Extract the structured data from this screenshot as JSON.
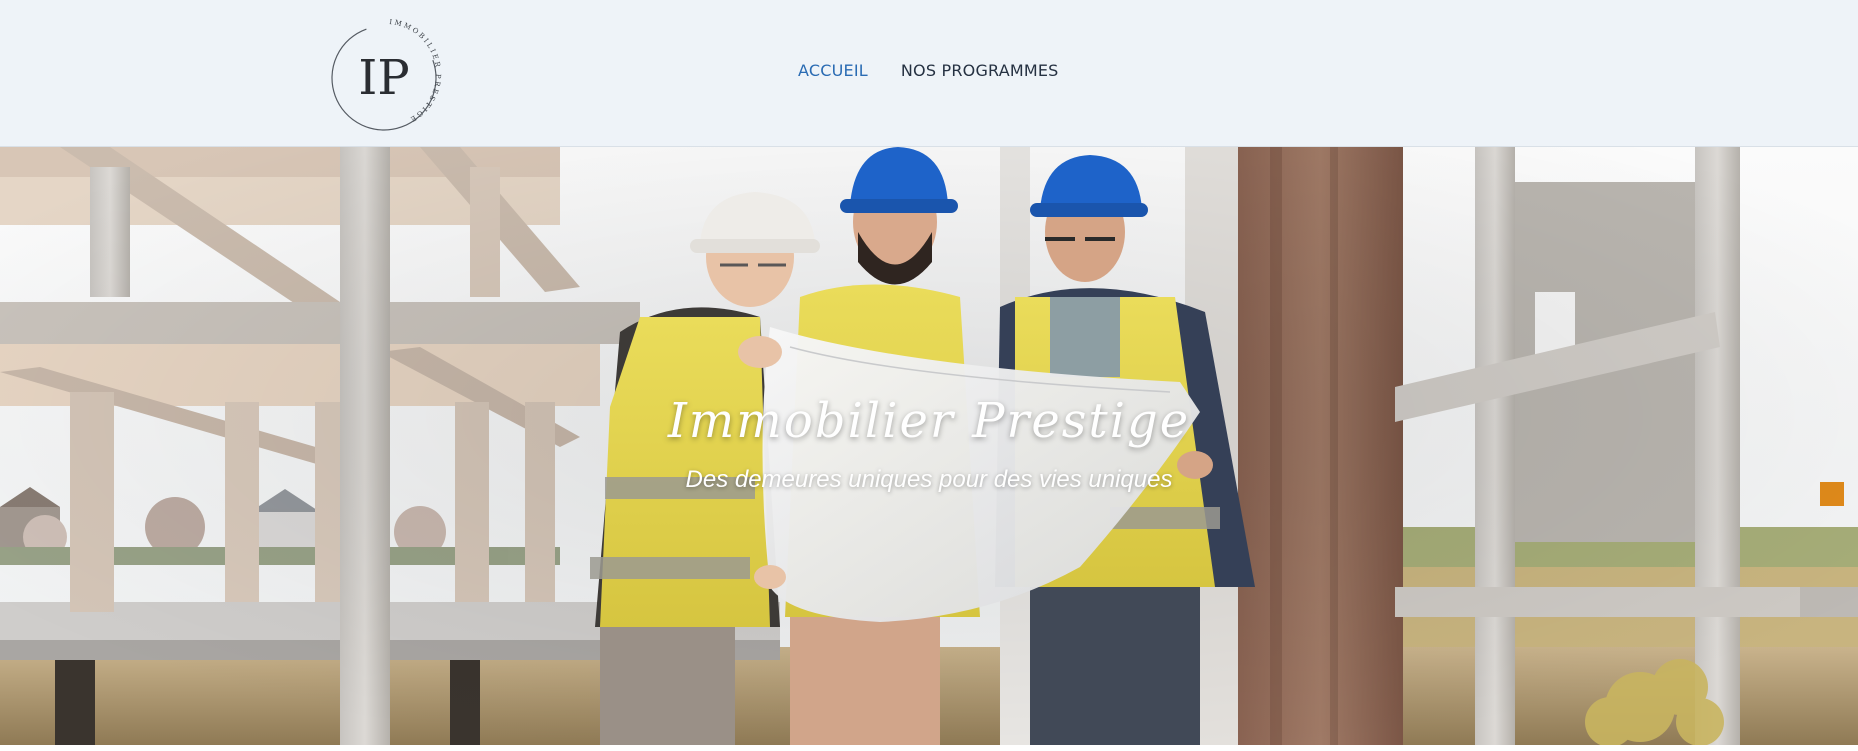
{
  "header": {
    "logo": {
      "monogram": "IP",
      "ring_text": "IMMOBILIER PRESTIGE",
      "icon": "monogram-logo"
    },
    "nav": [
      {
        "label": "ACCUEIL",
        "active": true
      },
      {
        "label": "NOS PROGRAMMES",
        "active": false
      }
    ]
  },
  "hero": {
    "title": "Immobilier Prestige",
    "subtitle": "Des demeures uniques pour des vies uniques",
    "image": "construction-site-photo"
  },
  "colors": {
    "header_bg": "#eef3f8",
    "nav_active": "#2a6bb3",
    "nav_default": "#253142",
    "hero_text": "#ffffff"
  }
}
